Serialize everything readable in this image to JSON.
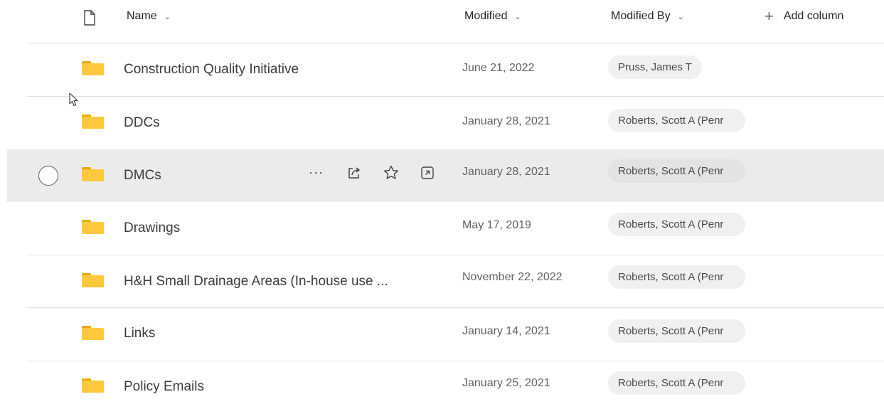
{
  "header": {
    "file_type_icon": "file-icon",
    "name_label": "Name",
    "modified_label": "Modified",
    "modified_by_label": "Modified By",
    "add_column_label": "Add column"
  },
  "rows": [
    {
      "name": "Construction Quality Initiative",
      "modified": "June 21, 2022",
      "modified_by": "Pruss, James T"
    },
    {
      "name": "DDCs",
      "modified": "January 28, 2021",
      "modified_by": "Roberts, Scott A (Penr"
    },
    {
      "name": "DMCs",
      "modified": "January 28, 2021",
      "modified_by": "Roberts, Scott A (Penr"
    },
    {
      "name": "Drawings",
      "modified": "May 17, 2019",
      "modified_by": "Roberts, Scott A (Penr"
    },
    {
      "name": "H&H Small Drainage Areas (In-house use ...",
      "modified": "November 22, 2022",
      "modified_by": "Roberts, Scott A (Penr"
    },
    {
      "name": "Links",
      "modified": "January 14, 2021",
      "modified_by": "Roberts, Scott A (Penr"
    },
    {
      "name": "Policy Emails",
      "modified": "January 25, 2021",
      "modified_by": "Roberts, Scott A (Penr"
    }
  ],
  "hover_actions": {
    "more": "···",
    "icons": [
      "more-icon",
      "share-icon",
      "favorite-star-icon",
      "open-details-icon"
    ]
  },
  "colors": {
    "folder": "#ffc83d",
    "folder_tab": "#e8a800",
    "selected_row": "#ebebeb",
    "pill": "#f0f0f0"
  }
}
